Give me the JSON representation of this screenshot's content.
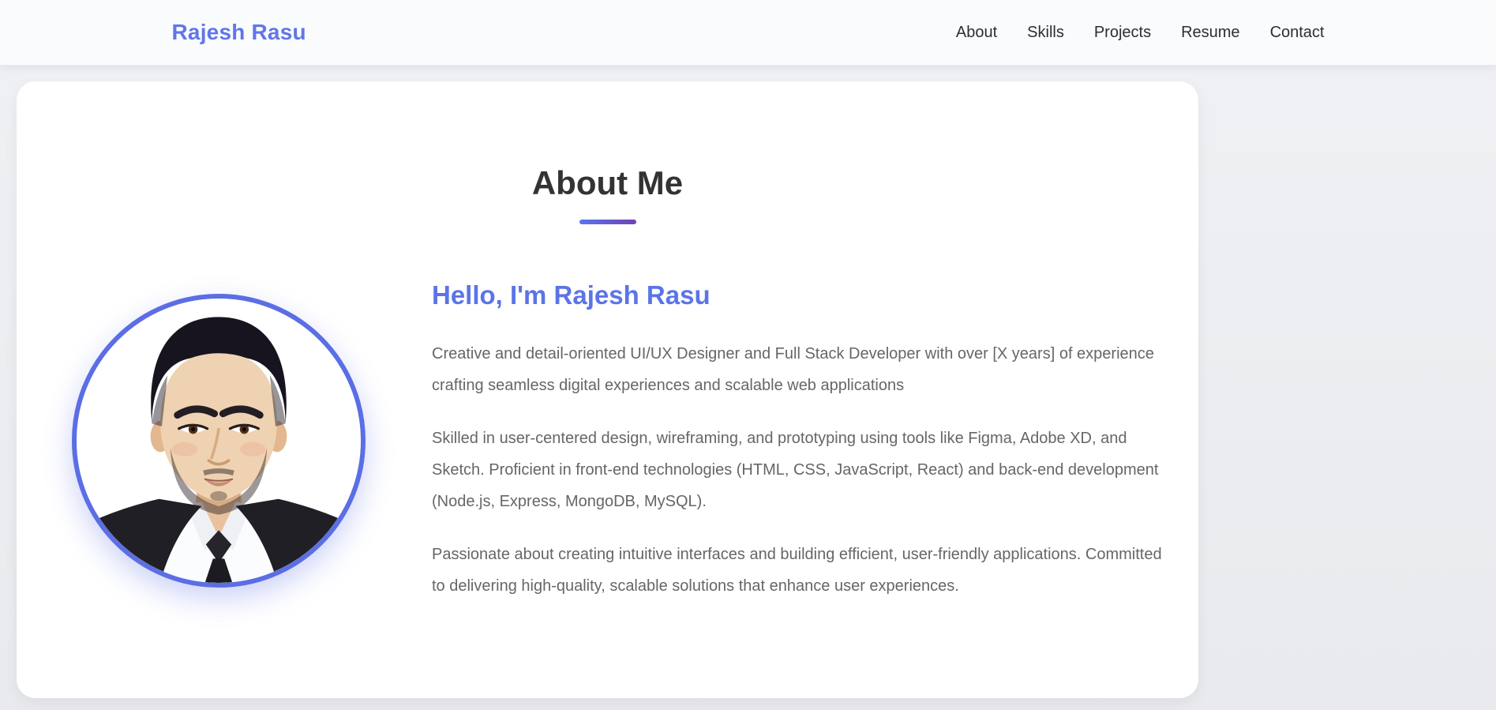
{
  "navbar": {
    "brand": "Rajesh Rasu",
    "links": [
      {
        "label": "About"
      },
      {
        "label": "Skills"
      },
      {
        "label": "Projects"
      },
      {
        "label": "Resume"
      },
      {
        "label": "Contact"
      }
    ]
  },
  "about": {
    "title": "About Me",
    "greeting": "Hello, I'm Rajesh Rasu",
    "paragraphs": [
      "Creative and detail-oriented UI/UX Designer and Full Stack Developer with over [X years] of experience crafting seamless digital experiences and scalable web applications",
      "Skilled in user-centered design, wireframing, and prototyping using tools like Figma, Adobe XD, and Sketch. Proficient in front-end technologies (HTML, CSS, JavaScript, React) and back-end development (Node.js, Express, MongoDB, MySQL).",
      "Passionate about creating intuitive interfaces and building efficient, user-friendly applications. Committed to delivering high-quality, scalable solutions that enhance user experiences."
    ],
    "photo": "portrait-of-rajesh-rasu"
  },
  "colors": {
    "brand_blue": "#6076e8",
    "greeting_blue": "#5b74e8",
    "underline_gradient_start": "#5b74ee",
    "underline_gradient_end": "#6f43b4",
    "photo_ring": "#5b6ee4",
    "title_dark": "#333333",
    "body_text_gray": "#666666",
    "navbar_bg": "#fafbfd",
    "page_bg": "#eef0f3",
    "card_bg": "#ffffff"
  }
}
